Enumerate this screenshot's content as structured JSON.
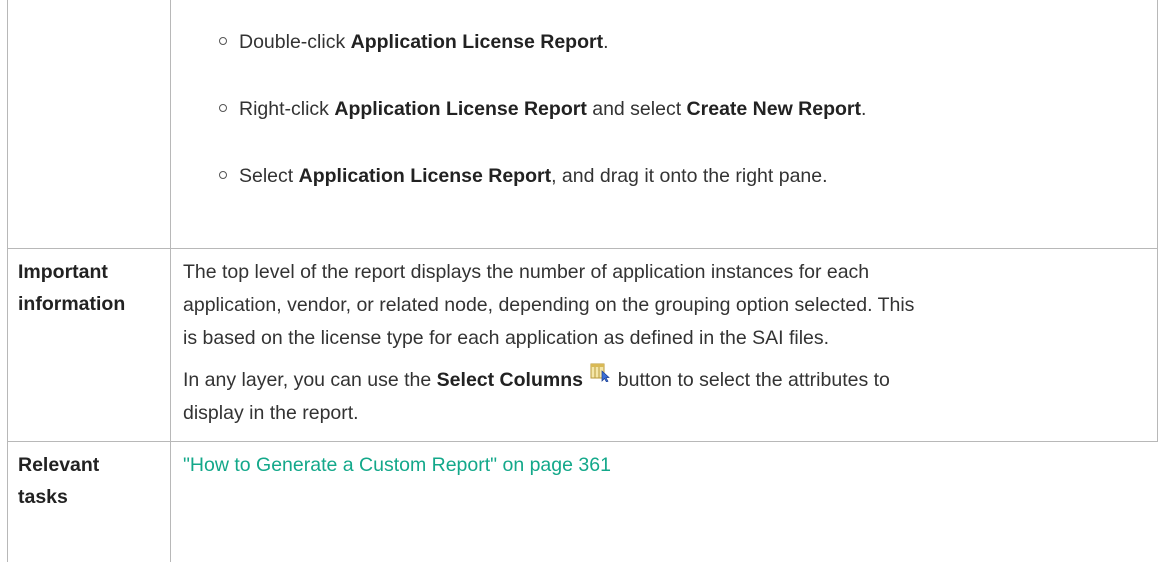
{
  "bullets": [
    {
      "pre": "Double-click ",
      "bold1": "Application License Report",
      "mid": ".",
      "bold2": "",
      "post": ""
    },
    {
      "pre": "Right-click ",
      "bold1": "Application License Report",
      "mid": " and select ",
      "bold2": "Create New Report",
      "post": "."
    },
    {
      "pre": "Select ",
      "bold1": "Application License Report",
      "mid": ", and drag it onto the right pane.",
      "bold2": "",
      "post": ""
    }
  ],
  "important": {
    "label_line1": "Important",
    "label_line2": "information",
    "lines": [
      "The top level of the report displays the number of application instances for each",
      "application, vendor, or related node, depending on the grouping option selected. This",
      "is based on the license type for each application as defined in the SAI files."
    ],
    "para2_pre": "In any layer, you can use the ",
    "para2_bold": "Select Columns",
    "para2_post": " button to select the attributes to",
    "para2_line2": "display in the report.",
    "icon": "select-columns-icon"
  },
  "relevant": {
    "label_line1": "Relevant",
    "label_line2": "tasks",
    "link_text": "\"How to Generate a Custom Report\" on page 361",
    "link_color": "#13a88a"
  }
}
